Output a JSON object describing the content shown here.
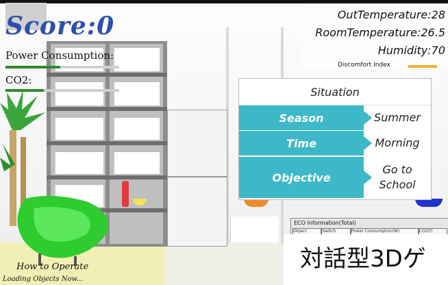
{
  "hud": {
    "score": "Score:0",
    "power_label": "Power Consumption:",
    "power_level": 0.48,
    "co2_label": "CO2:",
    "co2_level": 0.34
  },
  "environment": {
    "out_temperature": "OutTemperature:28",
    "room_temperature": "RoomTemperature:26.5",
    "humidity": "Humidity:70",
    "discomfort_label": "Discomfort Index",
    "discomfort_color": "#f0b429"
  },
  "situation": {
    "title": "Situation",
    "accent": "#3db8c9",
    "rows": [
      {
        "key": "Season",
        "value": "Summer"
      },
      {
        "key": "Time",
        "value": "Morning"
      },
      {
        "key": "Objective",
        "value": "Go to School"
      }
    ]
  },
  "eco": {
    "title": "ECO Information(Total)",
    "cells": [
      "Object",
      "Switch",
      "Power Consumption(W)",
      "CO2(t)"
    ]
  },
  "footer": {
    "how_to_operate": "How to Operate",
    "loading": "Loading Objects Now...",
    "banner_jp": "対話型3Dゲ"
  },
  "colors": {
    "score": "#2d4fb0",
    "bar": "#2e8b2e"
  }
}
